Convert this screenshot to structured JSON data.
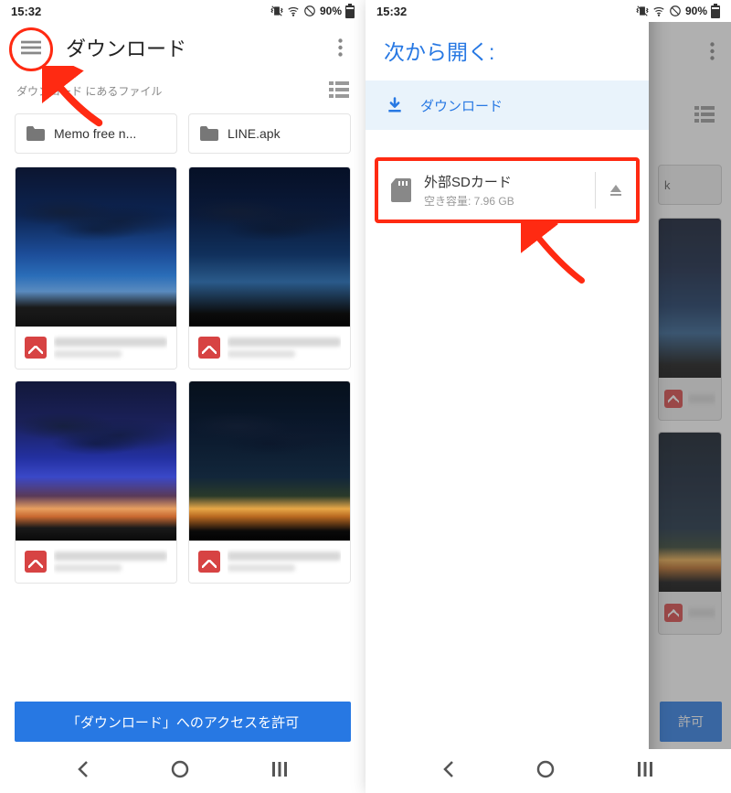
{
  "status": {
    "time": "15:32",
    "battery": "90%"
  },
  "left": {
    "title": "ダウンロード",
    "subheader": "ダウンロード にあるファイル",
    "folders": [
      {
        "label": "Memo free n..."
      },
      {
        "label": "LINE.apk"
      }
    ],
    "allow_button": "「ダウンロード」へのアクセスを許可"
  },
  "right": {
    "drawer_title": "次から開く:",
    "downloads_label": "ダウンロード",
    "sd": {
      "title": "外部SDカード",
      "subtitle": "空き容量: 7.96 GB"
    },
    "dim_folder_label": "k",
    "dim_button_label": "許可"
  }
}
